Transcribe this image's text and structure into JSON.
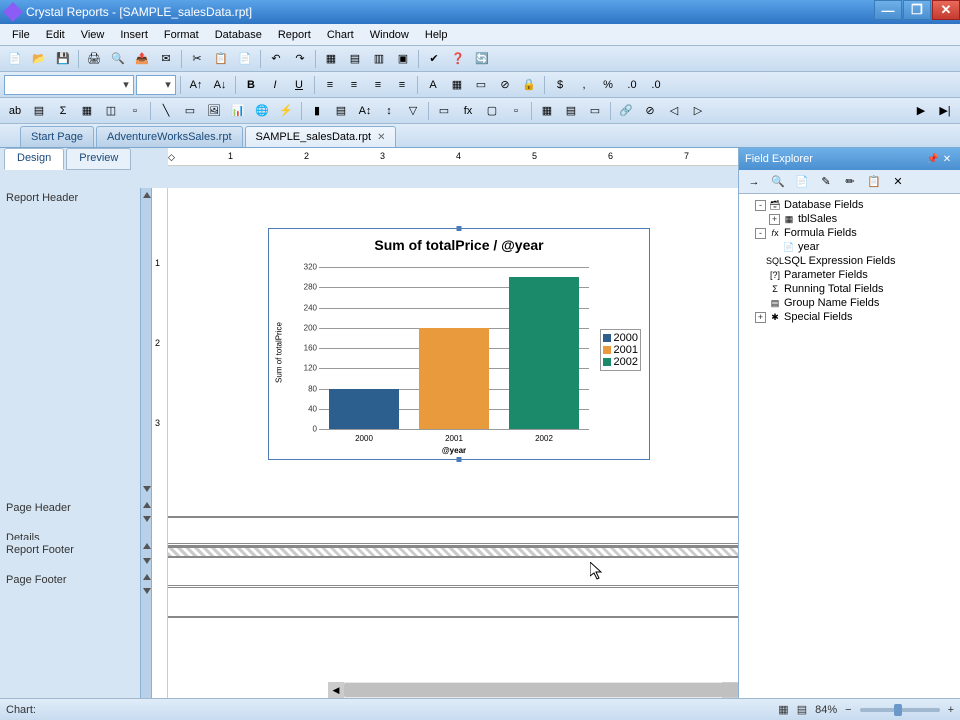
{
  "app": {
    "title": "Crystal Reports - [SAMPLE_salesData.rpt]"
  },
  "menus": [
    "File",
    "Edit",
    "View",
    "Insert",
    "Format",
    "Database",
    "Report",
    "Chart",
    "Window",
    "Help"
  ],
  "tabs": [
    {
      "label": "Start Page",
      "active": false,
      "closable": false
    },
    {
      "label": "AdventureWorksSales.rpt",
      "active": false,
      "closable": false
    },
    {
      "label": "SAMPLE_salesData.rpt",
      "active": true,
      "closable": true
    }
  ],
  "view_tabs": [
    {
      "label": "Design",
      "active": true
    },
    {
      "label": "Preview",
      "active": false
    }
  ],
  "sections": {
    "report_header": "Report Header",
    "page_header": "Page Header",
    "details": "Details",
    "report_footer": "Report Footer",
    "page_footer": "Page Footer"
  },
  "ruler_marks": [
    "1",
    "2",
    "3",
    "4",
    "5",
    "6",
    "7"
  ],
  "vruler_marks": [
    "1",
    "2",
    "3"
  ],
  "chart_data": {
    "type": "bar",
    "title": "Sum of totalPrice / @year",
    "xlabel": "@year",
    "ylabel": "Sum of totalPrice",
    "ylim": [
      0,
      320
    ],
    "categories": [
      "2000",
      "2001",
      "2002"
    ],
    "values": [
      80,
      200,
      300
    ],
    "yticks": [
      0,
      40,
      80,
      120,
      160,
      200,
      240,
      280,
      320
    ],
    "legend": [
      "2000",
      "2001",
      "2002"
    ],
    "colors": [
      "#2c5f8d",
      "#e89a3c",
      "#1a8a6a"
    ]
  },
  "field_explorer": {
    "title": "Field Explorer",
    "items": [
      {
        "label": "Database Fields",
        "level": 0,
        "expand": "-",
        "icon": "db"
      },
      {
        "label": "tblSales",
        "level": 1,
        "expand": "+",
        "icon": "table"
      },
      {
        "label": "Formula Fields",
        "level": 0,
        "expand": "-",
        "icon": "fx"
      },
      {
        "label": "year",
        "level": 1,
        "expand": null,
        "icon": "fx-item"
      },
      {
        "label": "SQL Expression Fields",
        "level": 0,
        "expand": null,
        "icon": "sql"
      },
      {
        "label": "Parameter Fields",
        "level": 0,
        "expand": null,
        "icon": "param"
      },
      {
        "label": "Running Total Fields",
        "level": 0,
        "expand": null,
        "icon": "sigma"
      },
      {
        "label": "Group Name Fields",
        "level": 0,
        "expand": null,
        "icon": "group"
      },
      {
        "label": "Special Fields",
        "level": 0,
        "expand": "+",
        "icon": "special"
      }
    ]
  },
  "status": {
    "left": "Chart:",
    "zoom": "84%"
  }
}
